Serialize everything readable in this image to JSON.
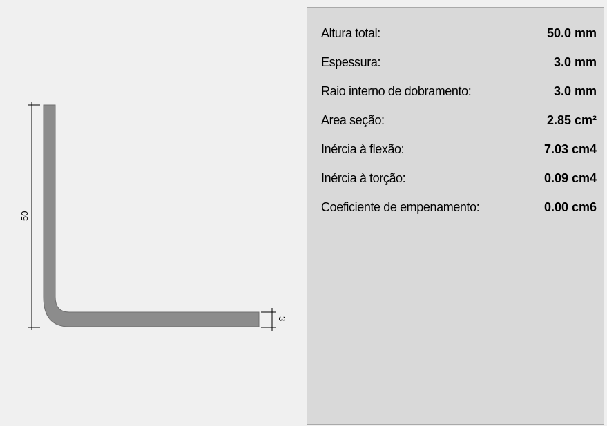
{
  "drawing": {
    "height_dim_label": "50",
    "thickness_dim_label": "3",
    "profile_fill_color": "#8c8c8c"
  },
  "properties": [
    {
      "label": "Altura total:",
      "value": "50.0 mm"
    },
    {
      "label": "Espessura:",
      "value": "3.0 mm"
    },
    {
      "label": "Raio interno de dobramento:",
      "value": "3.0 mm"
    },
    {
      "label": "Area seção:",
      "value": "2.85 cm²"
    },
    {
      "label": "Inércia à flexão:",
      "value": "7.03 cm4"
    },
    {
      "label": "Inércia à torção:",
      "value": "0.09 cm4"
    },
    {
      "label": "Coeficiente de empenamento:",
      "value": "0.00 cm6"
    }
  ]
}
